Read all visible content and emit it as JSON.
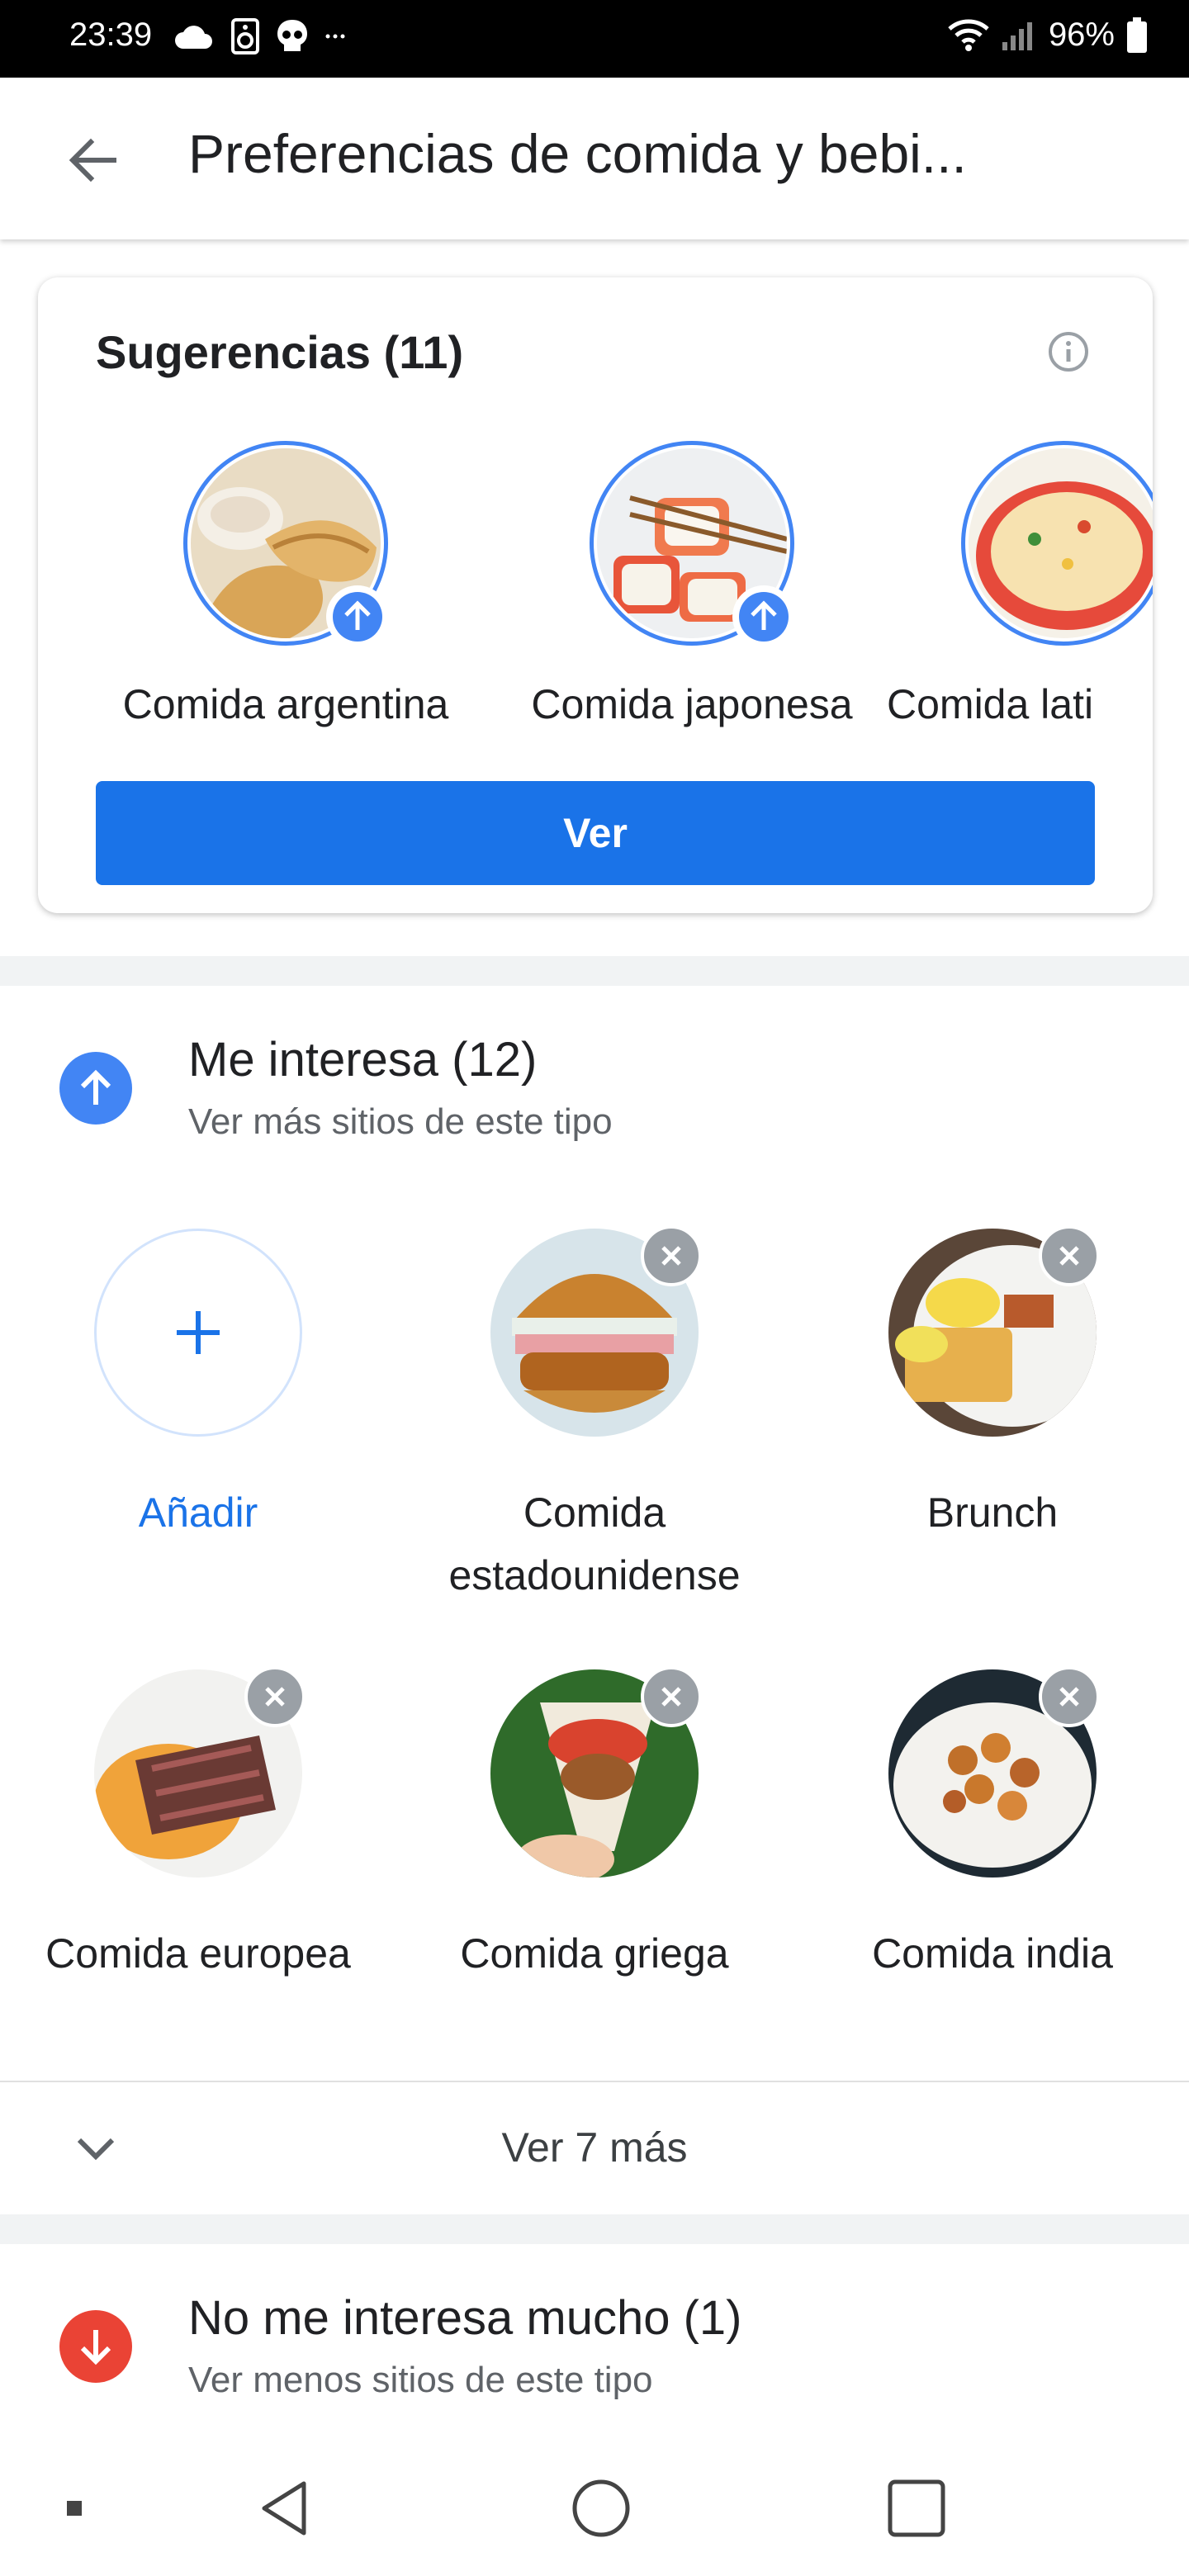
{
  "status_bar": {
    "time": "23:39",
    "battery": "96%"
  },
  "app_bar": {
    "title": "Preferencias de comida y bebi..."
  },
  "suggestions": {
    "title": "Sugerencias (11)",
    "items": [
      {
        "label": "Comida argentina"
      },
      {
        "label": "Comida japonesa"
      },
      {
        "label": "Comida lati"
      }
    ],
    "button_label": "Ver"
  },
  "likes": {
    "title": "Me interesa (12)",
    "subtitle": "Ver más sitios de este tipo",
    "add_label": "Añadir",
    "items": [
      {
        "label": "Comida estadounidense"
      },
      {
        "label": "Brunch"
      },
      {
        "label": "Comida europea"
      },
      {
        "label": "Comida griega"
      },
      {
        "label": "Comida india"
      }
    ],
    "more_label": "Ver 7 más"
  },
  "dislikes": {
    "title": "No me interesa mucho (1)",
    "subtitle": "Ver menos sitios de este tipo"
  },
  "colors": {
    "accent": "#1a73e8",
    "like": "#4285f4",
    "dislike": "#ea4335"
  }
}
